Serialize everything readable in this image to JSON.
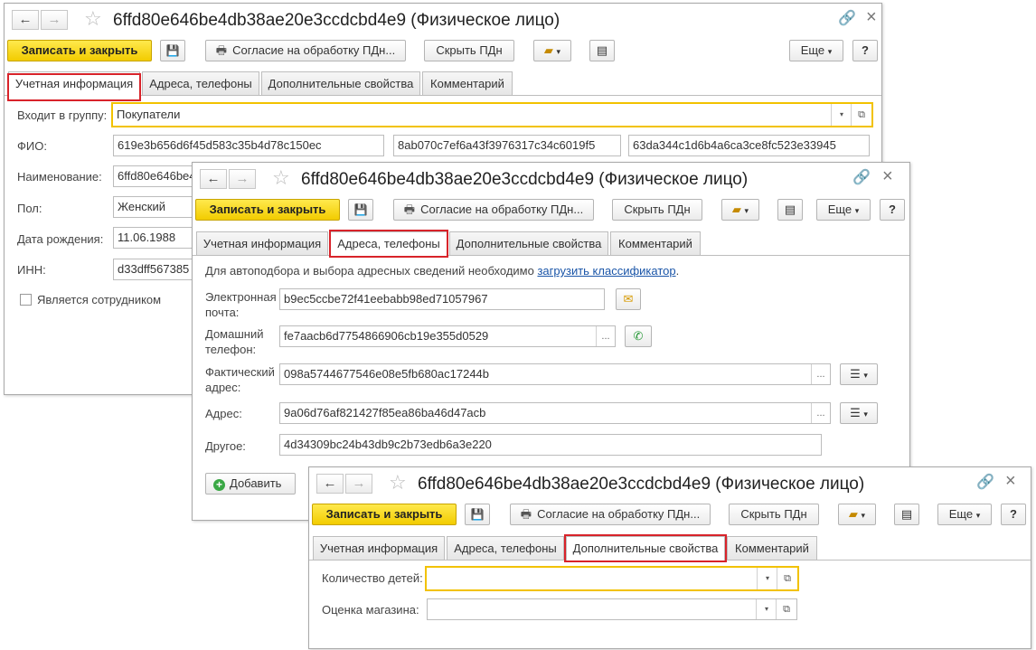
{
  "title": "6ffd80e646be4db38ae20e3ccdcbd4e9 (Физическое лицо)",
  "toolbar": {
    "save_close": "Записать и закрыть",
    "consent": "Согласие на обработку ПДн...",
    "hide_pd": "Скрыть ПДн",
    "more": "Еще",
    "help": "?"
  },
  "tabs": {
    "account": "Учетная информация",
    "addresses": "Адреса, телефоны",
    "extra": "Дополнительные свойства",
    "comment": "Комментарий"
  },
  "icons": {
    "back": "←",
    "forward": "→",
    "star": "☆",
    "link": "🔗",
    "close": "×",
    "save": "💾",
    "print": "🖶",
    "doc": "▤",
    "menu": "☰",
    "dropdown": "▾",
    "open": "⧉"
  },
  "colors": {
    "accent": "#f2cc00",
    "highlight": "#d8232a",
    "link": "#1a55a8"
  },
  "account": {
    "group_label": "Входит в группу:",
    "group_value": "Покупатели",
    "fio_label": "ФИО:",
    "fio_last": "619e3b656d6f45d583c35b4d78c150ec",
    "fio_first": "8ab070c7ef6a43f3976317c34c6019f5",
    "fio_middle": "63da344c1d6b4a6ca3ce8fc523e33945",
    "name_label": "Наименование:",
    "name_value": "6ffd80e646be4",
    "gender_label": "Пол:",
    "gender_value": "Женский",
    "birth_label": "Дата рождения:",
    "birth_value": "11.06.1988",
    "inn_label": "ИНН:",
    "inn_value": "d33dff567385",
    "employee_label": "Является сотрудником"
  },
  "contacts": {
    "info_text": "Для автоподбора и выбора адресных сведений необходимо",
    "info_link": "загрузить классификатор",
    "info_dot": ".",
    "email_label_1": "Электронная",
    "email_label_2": "почта:",
    "email_value": "b9ec5ccbe72f41eebabb98ed71057967",
    "phone_label_1": "Домашний",
    "phone_label_2": "телефон:",
    "phone_value": "fe7aacb6d7754866906cb19e355d0529",
    "actual_label_1": "Фактический",
    "actual_label_2": "адрес:",
    "actual_value": "098a5744677546e08e5fb680ac17244b",
    "address_label": "Адрес:",
    "address_value": "9a06d76af821427f85ea86ba46d47acb",
    "other_label": "Другое:",
    "other_value": "4d34309bc24b43db9c2b73edb6a3e220",
    "add_label": "Добавить"
  },
  "extra": {
    "children_label": "Количество детей:",
    "children_value": "",
    "rating_label": "Оценка магазина:",
    "rating_value": ""
  }
}
